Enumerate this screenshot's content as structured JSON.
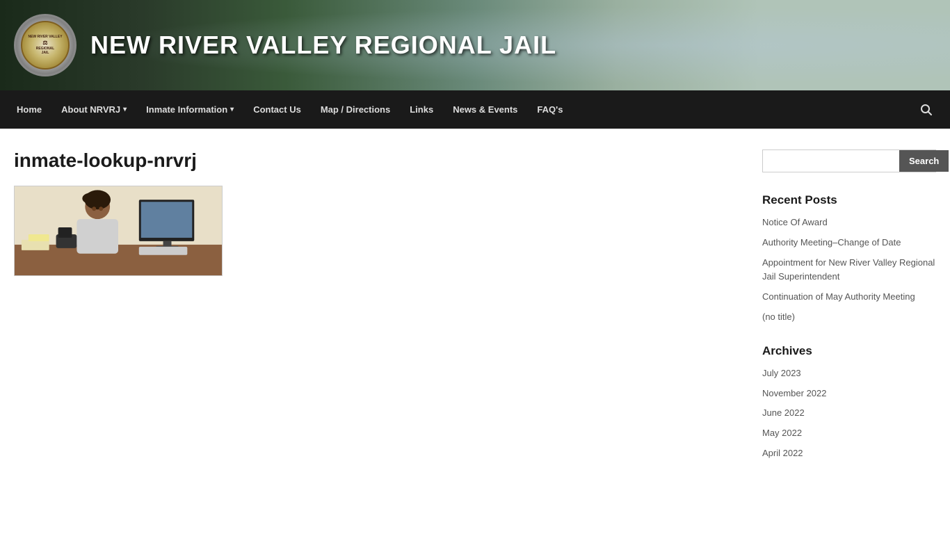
{
  "site": {
    "title": "NEW RIVER VALLEY REGIONAL JAIL",
    "logo_line1": "NEW RIVER VALLEY",
    "logo_line2": "REGIONAL",
    "logo_line3": "JAIL"
  },
  "nav": {
    "items": [
      {
        "label": "Home",
        "has_dropdown": false
      },
      {
        "label": "About NRVRJ",
        "has_dropdown": true
      },
      {
        "label": "Inmate Information",
        "has_dropdown": true
      },
      {
        "label": "Contact Us",
        "has_dropdown": false
      },
      {
        "label": "Map / Directions",
        "has_dropdown": false
      },
      {
        "label": "Links",
        "has_dropdown": false
      },
      {
        "label": "News & Events",
        "has_dropdown": false
      },
      {
        "label": "FAQ's",
        "has_dropdown": false
      }
    ],
    "search_label": "Search"
  },
  "main": {
    "page_title": "inmate-lookup-nrvrj",
    "image_alt": "Inmate lookup desk worker"
  },
  "sidebar": {
    "search": {
      "placeholder": "",
      "button_label": "Search"
    },
    "recent_posts": {
      "title": "Recent Posts",
      "items": [
        {
          "label": "Notice Of Award"
        },
        {
          "label": "Authority Meeting–Change of Date"
        },
        {
          "label": "Appointment for New River Valley Regional Jail Superintendent"
        },
        {
          "label": "Continuation of May Authority Meeting"
        },
        {
          "label": "(no title)"
        }
      ]
    },
    "archives": {
      "title": "Archives",
      "items": [
        {
          "label": "July 2023"
        },
        {
          "label": "November 2022"
        },
        {
          "label": "June 2022"
        },
        {
          "label": "May 2022"
        },
        {
          "label": "April 2022"
        }
      ]
    }
  }
}
